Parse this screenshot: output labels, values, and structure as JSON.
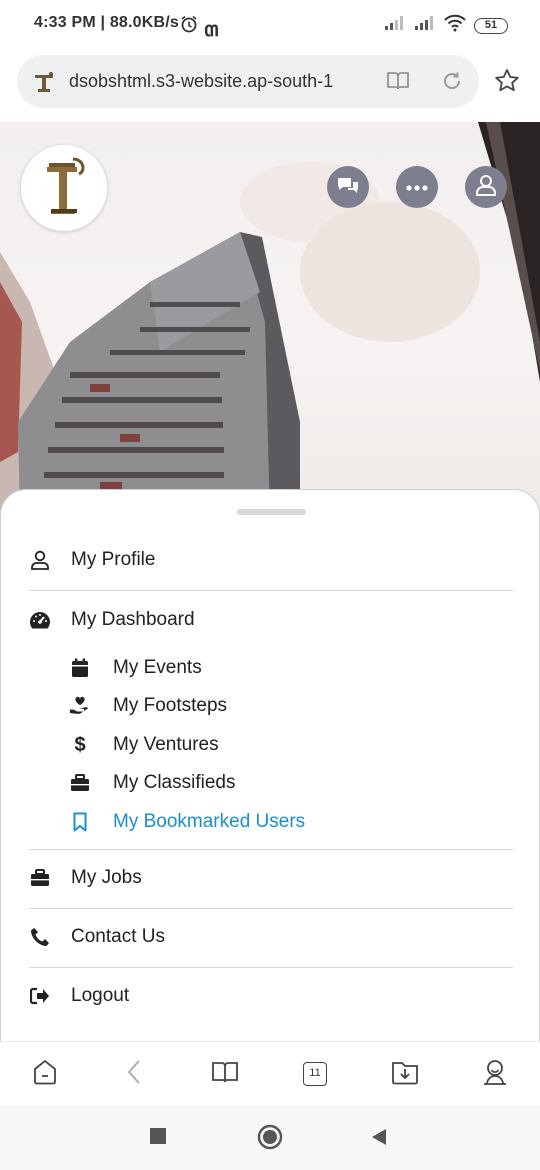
{
  "status_bar": {
    "time_speed": "4:33 PM | 88.0KB/s",
    "battery": "51"
  },
  "url_bar": {
    "url": "dsobshtml.s3-website.ap-south-1"
  },
  "header_buttons": [
    "chat-icon",
    "more-icon",
    "user-icon"
  ],
  "menu": {
    "profile": "My Profile",
    "dashboard": "My Dashboard",
    "sub_items": [
      {
        "label": "My Events",
        "icon": "calendar-icon"
      },
      {
        "label": "My Footsteps",
        "icon": "hand-heart-icon"
      },
      {
        "label": "My Ventures",
        "icon": "dollar-icon"
      },
      {
        "label": "My Classifieds",
        "icon": "briefcase-icon"
      },
      {
        "label": "My Bookmarked Users",
        "icon": "bookmark-icon"
      }
    ],
    "jobs": "My Jobs",
    "contact": "Contact Us",
    "logout": "Logout",
    "active_color": "#1a8fd0"
  },
  "toolbar": {
    "tab_count": "11"
  }
}
